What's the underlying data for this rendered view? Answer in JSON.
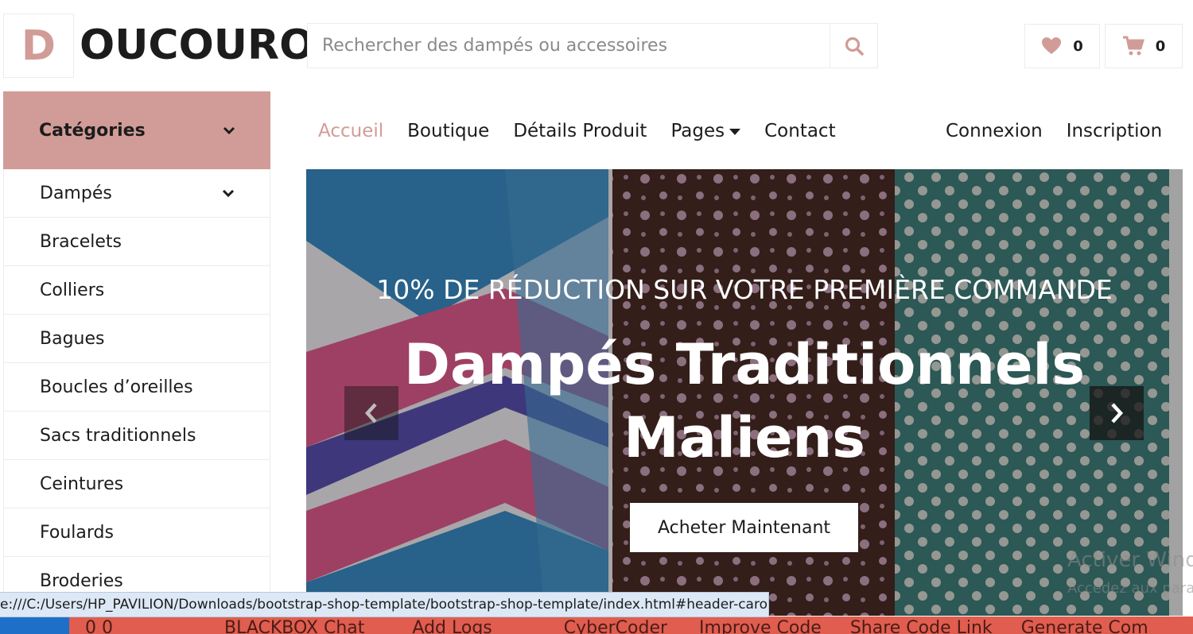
{
  "brand": {
    "logo_letter": "D",
    "name": "OUCOURO"
  },
  "search": {
    "placeholder": "Rechercher des dampés ou accessoires",
    "icon": "search-icon"
  },
  "header_actions": {
    "wishlist_count": "0",
    "cart_count": "0"
  },
  "sidebar": {
    "title": "Catégories",
    "items": [
      {
        "label": "Dampés",
        "has_submenu": true
      },
      {
        "label": "Bracelets"
      },
      {
        "label": "Colliers"
      },
      {
        "label": "Bagues"
      },
      {
        "label": "Boucles d’oreilles"
      },
      {
        "label": "Sacs traditionnels"
      },
      {
        "label": "Ceintures"
      },
      {
        "label": "Foulards"
      },
      {
        "label": "Broderies"
      }
    ]
  },
  "nav": {
    "links": [
      "Accueil",
      "Boutique",
      "Détails Produit",
      "Pages",
      "Contact"
    ],
    "active": "Accueil",
    "auth": [
      "Connexion",
      "Inscription"
    ]
  },
  "carousel": {
    "promo": "10% DE RÉDUCTION SUR VOTRE PREMIÈRE COMMANDE",
    "title": "Dampés Traditionnels Maliens",
    "cta": "Acheter Maintenant"
  },
  "windows_watermark": {
    "line1": "Activer Windows",
    "line2": "Accédez aux paramètres"
  },
  "status_url": "e:///C:/Users/HP_PAVILION/Downloads/bootstrap-shop-template/bootstrap-shop-template/index.html#header-carousel",
  "taskbar": {
    "counts": "0  0",
    "items": [
      "BLACKBOX Chat",
      "Add Logs",
      "CyberCoder",
      "Improve Code",
      "Share Code Link",
      "Generate Com"
    ]
  },
  "colors": {
    "accent": "#d19c97",
    "text": "#1c1c1c",
    "border": "#ececec"
  }
}
